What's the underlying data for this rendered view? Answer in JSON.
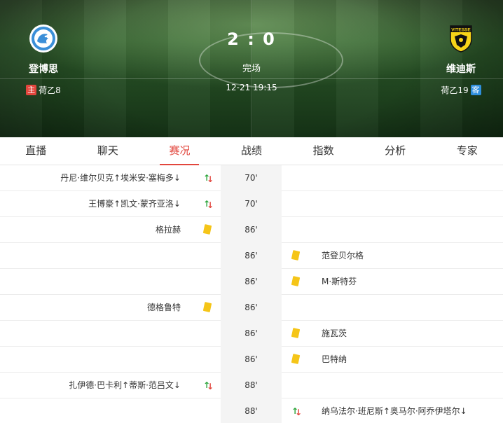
{
  "match": {
    "home": {
      "name": "登博思",
      "side_tag": "主",
      "league_rank": "荷乙8",
      "logo": "den-bosch-crest-icon"
    },
    "away": {
      "name": "维迪斯",
      "side_tag": "客",
      "league_rank": "荷乙19",
      "logo": "vitesse-crest-icon",
      "logo_text": "VITESSE"
    },
    "score": "2 : 0",
    "status": "完场",
    "datetime": "12-21 19:15"
  },
  "tabs": [
    {
      "label": "直播"
    },
    {
      "label": "聊天"
    },
    {
      "label": "赛况",
      "active": true
    },
    {
      "label": "战绩"
    },
    {
      "label": "指数"
    },
    {
      "label": "分析"
    },
    {
      "label": "专家"
    }
  ],
  "colors": {
    "accent": "#e2463d",
    "away_tag": "#2f8fdd",
    "yellow_card": "#f5c518",
    "sub_in": "#2aa43a"
  },
  "events": [
    {
      "minute": "70'",
      "side": "home",
      "type": "substitution",
      "text": "丹尼·维尔贝克↑埃米安·塞梅多↓"
    },
    {
      "minute": "70'",
      "side": "home",
      "type": "substitution",
      "text": "王博豪↑凯文·蒙齐亚洛↓"
    },
    {
      "minute": "86'",
      "side": "home",
      "type": "yellow-card",
      "text": "格拉赫"
    },
    {
      "minute": "86'",
      "side": "away",
      "type": "yellow-card",
      "text": "范登贝尔格"
    },
    {
      "minute": "86'",
      "side": "away",
      "type": "yellow-card",
      "text": "M·斯特芬"
    },
    {
      "minute": "86'",
      "side": "home",
      "type": "yellow-card",
      "text": "德格鲁特"
    },
    {
      "minute": "86'",
      "side": "away",
      "type": "yellow-card",
      "text": "施瓦茨"
    },
    {
      "minute": "86'",
      "side": "away",
      "type": "yellow-card",
      "text": "巴特纳"
    },
    {
      "minute": "88'",
      "side": "home",
      "type": "substitution",
      "text": "扎伊德·巴卡利↑蒂斯·范吕文↓"
    },
    {
      "minute": "88'",
      "side": "away",
      "type": "substitution",
      "text": "纳乌法尔·班尼斯↑奥马尔·阿乔伊塔尔↓"
    }
  ]
}
